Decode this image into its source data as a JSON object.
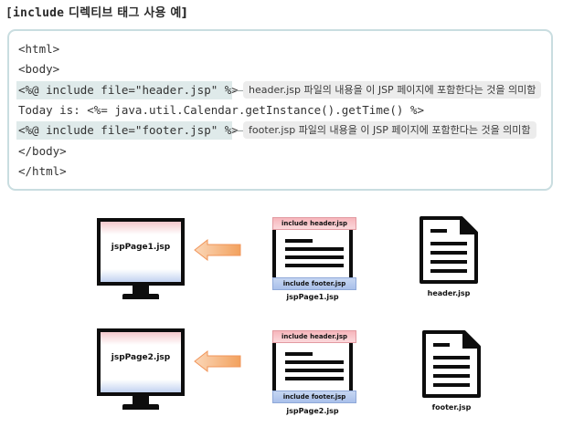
{
  "title": {
    "code_part": "[include",
    "text_part": " 디렉티브 태그 사용 예]"
  },
  "code": {
    "lines": [
      "<html>",
      "<body>",
      "<%@ include file=\"header.jsp\" %>",
      "Today is: <%= java.util.Calendar.getInstance().getTime() %>",
      "<%@ include file=\"footer.jsp\" %>",
      "</body>",
      "</html>"
    ],
    "notes": [
      "header.jsp 파일의 내용을 이 JSP 페이지에 포함한다는 것을 의미함",
      "footer.jsp 파일의 내용을 이 JSP 페이지에 포함한다는 것을 의미함"
    ]
  },
  "diagram": {
    "row1": {
      "monitor_label": "jspPage1.jsp",
      "header_label": "include header.jsp",
      "footer_label": "include footer.jsp",
      "page_caption": "jspPage1.jsp",
      "doc_caption": "header.jsp"
    },
    "row2": {
      "monitor_label": "jspPage2.jsp",
      "header_label": "include header.jsp",
      "footer_label": "include footer.jsp",
      "page_caption": "jspPage2.jsp",
      "doc_caption": "footer.jsp"
    },
    "colors": {
      "header_band": "#f6b6bc",
      "footer_band": "#a9c0ea",
      "arrow": "#f2a15e",
      "code_highlight": "#dfeaea",
      "box_border": "#c9dde0"
    }
  }
}
